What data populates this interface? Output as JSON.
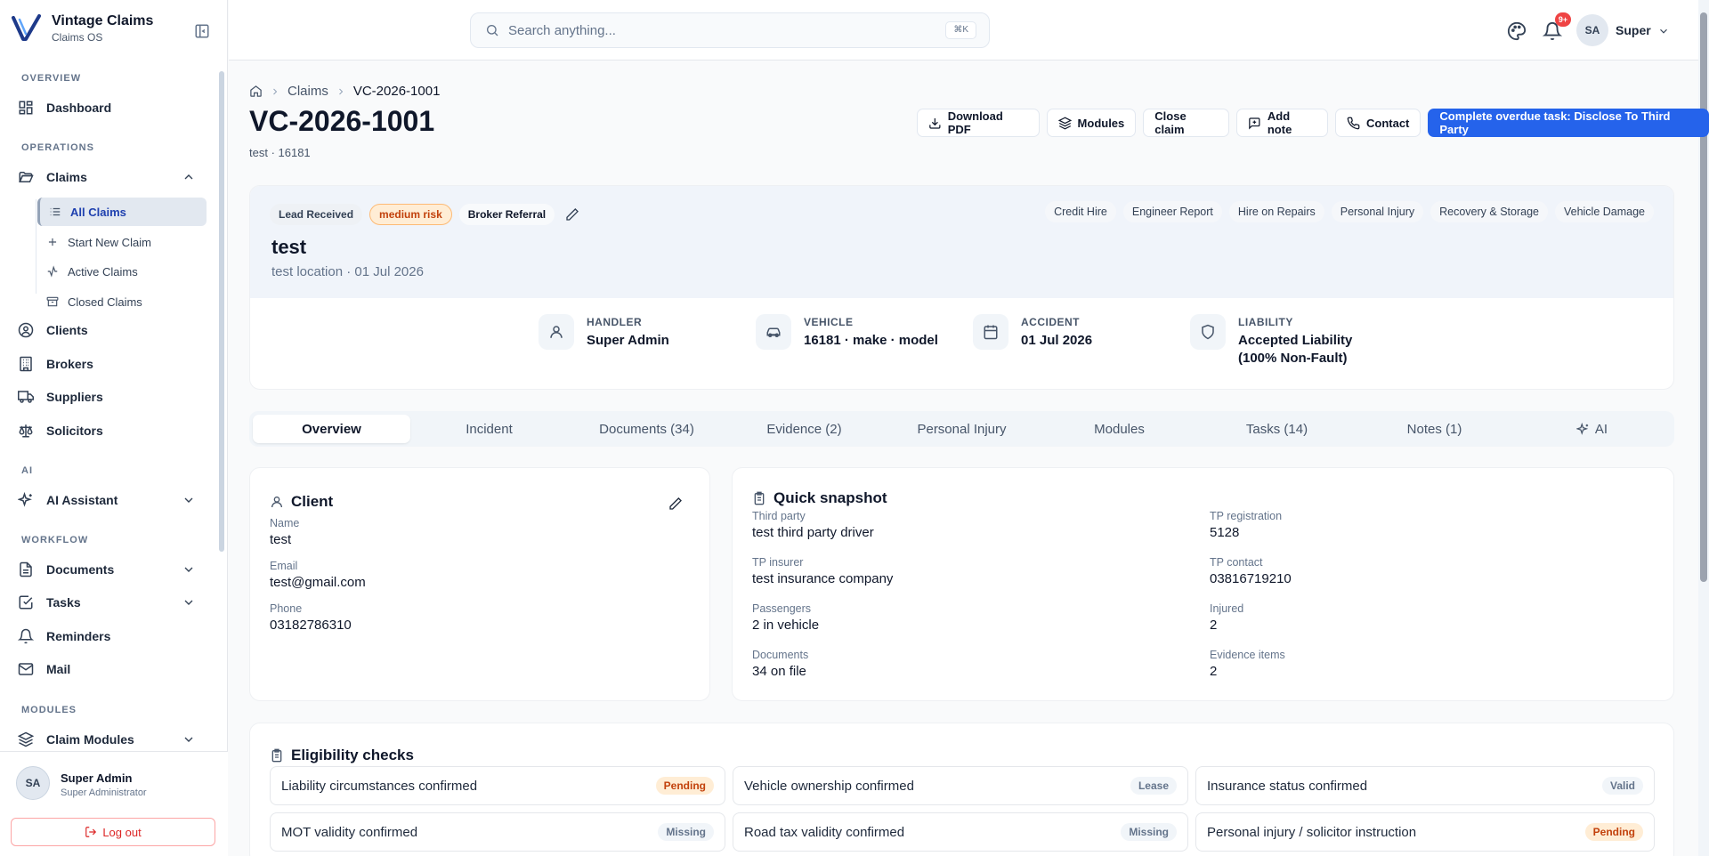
{
  "brand": {
    "name": "Vintage Claims",
    "subtitle": "Claims OS"
  },
  "sidebar": {
    "sections": {
      "overview": "OVERVIEW",
      "operations": "OPERATIONS",
      "ai": "AI",
      "workflow": "WORKFLOW",
      "modules": "MODULES"
    },
    "items": {
      "dashboard": "Dashboard",
      "claims": "Claims",
      "all_claims": "All Claims",
      "start_new_claim": "Start New Claim",
      "active_claims": "Active Claims",
      "closed_claims": "Closed Claims",
      "clients": "Clients",
      "brokers": "Brokers",
      "suppliers": "Suppliers",
      "solicitors": "Solicitors",
      "ai_assistant": "AI Assistant",
      "documents": "Documents",
      "tasks": "Tasks",
      "reminders": "Reminders",
      "mail": "Mail",
      "claim_modules": "Claim Modules"
    },
    "user": {
      "initials": "SA",
      "name": "Super Admin",
      "role": "Super Administrator"
    },
    "logout_label": "Log out"
  },
  "topbar": {
    "search_placeholder": "Search anything...",
    "search_shortcut": "⌘K",
    "notification_count": "9+",
    "user_initials": "SA",
    "user_name": "Super"
  },
  "breadcrumb": {
    "claims": "Claims",
    "current": "VC-2026-1001"
  },
  "page": {
    "title": "VC-2026-1001",
    "subtitle": "test · 16181"
  },
  "actions": {
    "download_pdf": "Download PDF",
    "modules": "Modules",
    "close_claim": "Close claim",
    "add_note": "Add note",
    "contact": "Contact",
    "primary": "Complete overdue task: Disclose To Third Party"
  },
  "hero": {
    "status": "Lead Received",
    "risk": "medium risk",
    "source": "Broker Referral",
    "tags": [
      "Credit Hire",
      "Engineer Report",
      "Hire on Repairs",
      "Personal Injury",
      "Recovery & Storage",
      "Vehicle Damage"
    ],
    "name": "test",
    "location": "test location · 01 Jul 2026",
    "meta": {
      "handler_label": "HANDLER",
      "handler": "Super Admin",
      "vehicle_label": "VEHICLE",
      "vehicle": "16181 · make · model",
      "accident_label": "ACCIDENT",
      "accident": "01 Jul 2026",
      "liability_label": "LIABILITY",
      "liability_line1": "Accepted Liability",
      "liability_line2": "(100% Non-Fault)"
    }
  },
  "tabs": [
    "Overview",
    "Incident",
    "Documents (34)",
    "Evidence (2)",
    "Personal Injury",
    "Modules",
    "Tasks (14)",
    "Notes (1)",
    "AI"
  ],
  "client": {
    "title": "Client",
    "name_label": "Name",
    "name": "test",
    "email_label": "Email",
    "email": "test@gmail.com",
    "phone_label": "Phone",
    "phone": "03182786310"
  },
  "snapshot": {
    "title": "Quick snapshot",
    "third_party_label": "Third party",
    "third_party": "test third party driver",
    "tp_reg_label": "TP registration",
    "tp_reg": "5128",
    "tp_insurer_label": "TP insurer",
    "tp_insurer": "test insurance company",
    "tp_contact_label": "TP contact",
    "tp_contact": "03816719210",
    "passengers_label": "Passengers",
    "passengers": "2 in vehicle",
    "injured_label": "Injured",
    "injured": "2",
    "documents_label": "Documents",
    "documents": "34 on file",
    "evidence_label": "Evidence items",
    "evidence": "2"
  },
  "eligibility": {
    "title": "Eligibility checks",
    "items": [
      {
        "label": "Liability circumstances confirmed",
        "status": "Pending"
      },
      {
        "label": "Vehicle ownership confirmed",
        "status": "Lease"
      },
      {
        "label": "Insurance status confirmed",
        "status": "Valid"
      },
      {
        "label": "MOT validity confirmed",
        "status": "Missing"
      },
      {
        "label": "Road tax validity confirmed",
        "status": "Missing"
      },
      {
        "label": "Personal injury / solicitor instruction",
        "status": "Pending"
      }
    ]
  }
}
